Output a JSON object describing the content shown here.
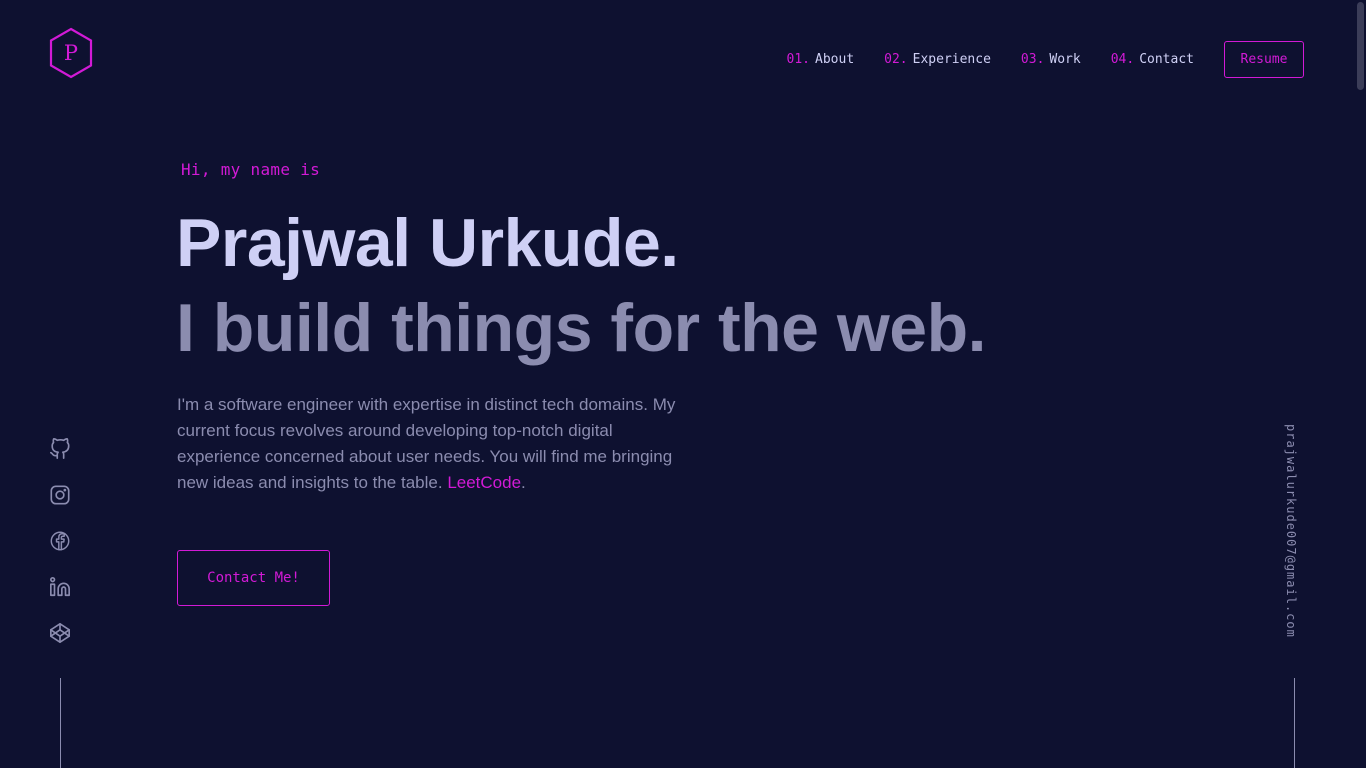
{
  "logo": {
    "letter": "P",
    "icon": "hexagon-logo-icon"
  },
  "nav": {
    "items": [
      {
        "num": "01.",
        "label": "About"
      },
      {
        "num": "02.",
        "label": "Experience"
      },
      {
        "num": "03.",
        "label": "Work"
      },
      {
        "num": "04.",
        "label": "Contact"
      }
    ],
    "resume_label": "Resume"
  },
  "hero": {
    "greeting": "Hi, my name is",
    "name": "Prajwal Urkude.",
    "tagline": "I build things for the web.",
    "intro": "I'm a software engineer with expertise in distinct tech domains. My current focus revolves around developing top-notch digital experience concerned about user needs. You will find me bringing new ideas and insights to the table.",
    "intro_link": "LeetCode",
    "intro_end": ".",
    "contact_label": "Contact Me!"
  },
  "socials": [
    {
      "icon": "github-icon"
    },
    {
      "icon": "instagram-icon"
    },
    {
      "icon": "facebook-icon"
    },
    {
      "icon": "linkedin-icon"
    },
    {
      "icon": "codepen-icon"
    }
  ],
  "email": "prajwalurkude007@gmail.com",
  "colors": {
    "background": "#0e1130",
    "accent": "#d21ad6",
    "text_light": "#cfd0f5",
    "text_muted": "#8b8caf"
  }
}
